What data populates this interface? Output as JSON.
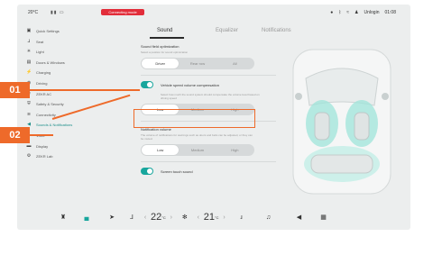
{
  "statusbar": {
    "temperature": "20°C",
    "alert": "Connecting mode",
    "user": "Unlogin",
    "time": "01:08"
  },
  "sidebar": {
    "items": [
      {
        "label": "Quick Settings",
        "icon": "quick-settings-icon"
      },
      {
        "label": "Seat",
        "icon": "seat-icon"
      },
      {
        "label": "Light",
        "icon": "light-icon"
      },
      {
        "label": "Doors & Windows",
        "icon": "door-icon"
      },
      {
        "label": "Charging",
        "icon": "charging-icon"
      },
      {
        "label": "Driving",
        "icon": "driving-icon"
      },
      {
        "label": "ZEKR AC",
        "icon": "ac-icon"
      },
      {
        "label": "Safety & Security",
        "icon": "safety-icon"
      },
      {
        "label": "Connectivity",
        "icon": "connectivity-icon"
      },
      {
        "label": "Sounds & Notifications",
        "icon": "sound-icon",
        "active": true
      },
      {
        "label": "Voice",
        "icon": "voice-icon"
      },
      {
        "label": "Display",
        "icon": "display-icon"
      },
      {
        "label": "ZEKR Lab",
        "icon": "lab-icon"
      }
    ]
  },
  "tabs": [
    {
      "label": "Sound"
    },
    {
      "label": "Equalizer"
    },
    {
      "label": "Notifications"
    }
  ],
  "sound_field": {
    "title": "Sound field optimization",
    "desc": "Select a position for sound optimization",
    "options": [
      "Driver",
      "Rear row",
      "All"
    ],
    "selected": "Driver"
  },
  "speed_comp": {
    "label": "Vehicle speed volume compensation",
    "desc": "Select how much the sound system should compensate the volume level based on driving speed",
    "options": [
      "Low",
      "Medium",
      "High"
    ],
    "selected": "Low"
  },
  "notification_volume": {
    "title": "Notification volume",
    "desc": "The volume of notifications for warnings such as doors and belts can be adjusted, or they can be muted.",
    "options": [
      "Low",
      "Medium",
      "High"
    ],
    "selected": "Low"
  },
  "screen_touch": {
    "label": "Screen touch sound"
  },
  "bottombar": {
    "temp_left": "22",
    "temp_right": "21",
    "temp_unit": "°C"
  },
  "callouts": {
    "one": "01",
    "two": "02"
  },
  "colors": {
    "accent": "#18a69d",
    "callout": "#ee6a2a",
    "alert": "#e22d3a"
  }
}
